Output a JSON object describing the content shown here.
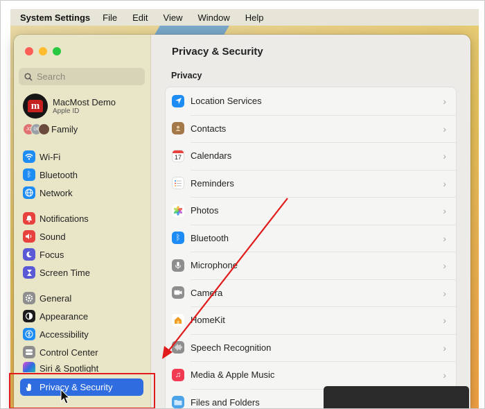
{
  "menubar": {
    "app": "System Settings",
    "items": [
      "File",
      "Edit",
      "View",
      "Window",
      "Help"
    ]
  },
  "search": {
    "placeholder": "Search"
  },
  "account": {
    "name": "MacMost Demo",
    "subtitle": "Apple ID",
    "avatar_letter": "m"
  },
  "family": {
    "label": "Family",
    "avatar_initials": [
      "JC",
      "DE",
      ""
    ]
  },
  "sidebar": {
    "items": [
      {
        "label": "Wi-Fi",
        "icon": "wifi-icon",
        "color": "#1e8cf5"
      },
      {
        "label": "Bluetooth",
        "icon": "bluetooth-icon",
        "color": "#1e8cf5"
      },
      {
        "label": "Network",
        "icon": "globe-icon",
        "color": "#1e8cf5"
      },
      {
        "label": "Notifications",
        "icon": "bell-icon",
        "color": "#e8423e"
      },
      {
        "label": "Sound",
        "icon": "speaker-icon",
        "color": "#e8423e"
      },
      {
        "label": "Focus",
        "icon": "moon-icon",
        "color": "#5a5ad6"
      },
      {
        "label": "Screen Time",
        "icon": "hourglass-icon",
        "color": "#5a5ad6"
      },
      {
        "label": "General",
        "icon": "gear-icon",
        "color": "#8e8e8e"
      },
      {
        "label": "Appearance",
        "icon": "appearance-icon",
        "color": "#1c1c1c"
      },
      {
        "label": "Accessibility",
        "icon": "accessibility-icon",
        "color": "#1e8cf5"
      },
      {
        "label": "Control Center",
        "icon": "control-center-icon",
        "color": "#8e8e8e"
      },
      {
        "label": "Siri & Spotlight",
        "icon": "siri-icon",
        "color": "#222222"
      },
      {
        "label": "Privacy & Security",
        "icon": "hand-icon",
        "color": "#2f6ce0"
      }
    ]
  },
  "content": {
    "title": "Privacy & Security",
    "section": "Privacy",
    "rows": [
      {
        "label": "Location Services",
        "icon": "location-arrow-icon",
        "color": "#1e8cf5"
      },
      {
        "label": "Contacts",
        "icon": "contacts-icon",
        "color": "#a4794a"
      },
      {
        "label": "Calendars",
        "icon": "calendar-icon",
        "color": "#ffffff",
        "text": "17"
      },
      {
        "label": "Reminders",
        "icon": "reminders-icon",
        "color": "#ffffff"
      },
      {
        "label": "Photos",
        "icon": "photos-icon",
        "color": "#ffffff"
      },
      {
        "label": "Bluetooth",
        "icon": "bluetooth-icon",
        "color": "#1e8cf5"
      },
      {
        "label": "Microphone",
        "icon": "microphone-icon",
        "color": "#8e8e8e"
      },
      {
        "label": "Camera",
        "icon": "camera-icon",
        "color": "#8e8e8e"
      },
      {
        "label": "HomeKit",
        "icon": "home-icon",
        "color": "#ffffff"
      },
      {
        "label": "Speech Recognition",
        "icon": "waveform-icon",
        "color": "#8e8e8e"
      },
      {
        "label": "Media & Apple Music",
        "icon": "music-note-icon",
        "color": "#f23b52"
      },
      {
        "label": "Files and Folders",
        "icon": "folder-icon",
        "color": "#4ca3e8"
      }
    ]
  },
  "colors": {
    "accent": "#2f6ce0",
    "annotation": "#e11b1b"
  }
}
